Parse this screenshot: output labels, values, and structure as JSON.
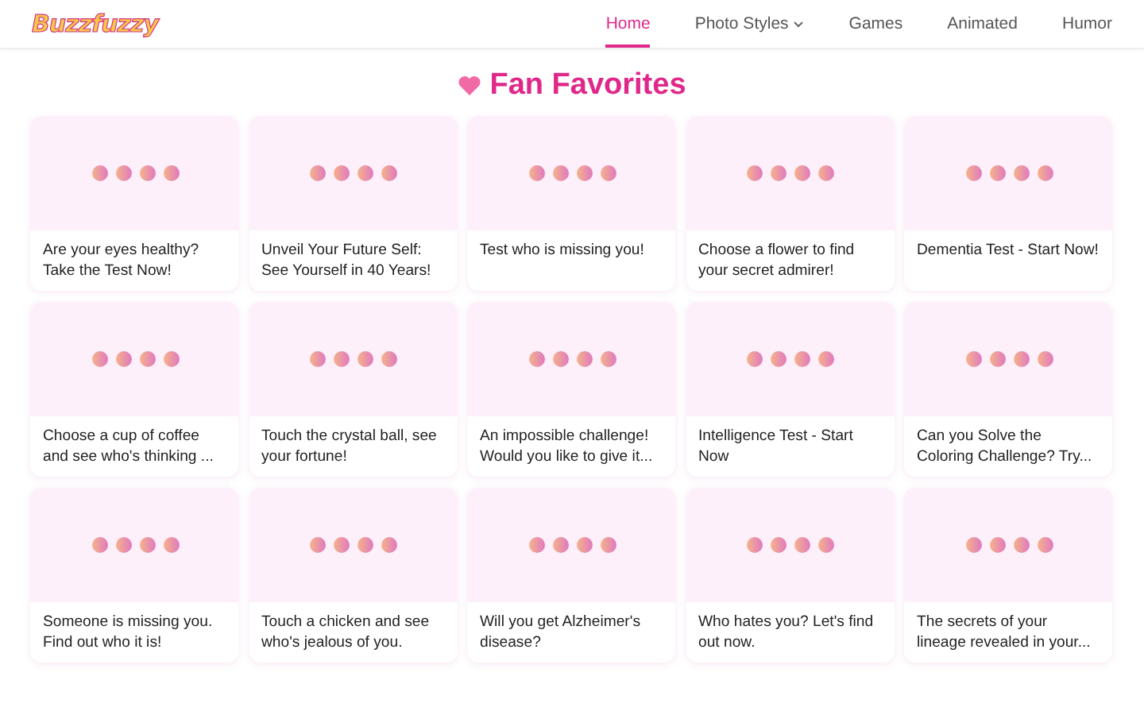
{
  "logo": "Buzzfuzzy",
  "nav": [
    {
      "label": "Home",
      "selected": true,
      "dropdown": false
    },
    {
      "label": "Photo Styles",
      "selected": false,
      "dropdown": true
    },
    {
      "label": "Games",
      "selected": false,
      "dropdown": false
    },
    {
      "label": "Animated",
      "selected": false,
      "dropdown": false
    },
    {
      "label": "Humor",
      "selected": false,
      "dropdown": false
    }
  ],
  "heading": "Fan Favorites",
  "cards": [
    {
      "title": "Are your eyes healthy? Take the Test Now!"
    },
    {
      "title": "Unveil Your Future Self: See Yourself in 40 Years!"
    },
    {
      "title": "Test who is missing you!"
    },
    {
      "title": "Choose a flower to find your secret admirer!"
    },
    {
      "title": "Dementia Test - Start Now!"
    },
    {
      "title": "Choose a cup of coffee and see who's thinking ..."
    },
    {
      "title": "Touch the crystal ball, see your fortune!"
    },
    {
      "title": "An impossible challenge! Would you like to give it..."
    },
    {
      "title": "Intelligence Test - Start Now"
    },
    {
      "title": "Can you Solve the Coloring Challenge? Try..."
    },
    {
      "title": "Someone is missing you. Find out who it is!"
    },
    {
      "title": "Touch a chicken and see who's jealous of you."
    },
    {
      "title": "Will you get Alzheimer's disease?"
    },
    {
      "title": "Who hates you? Let's find out now."
    },
    {
      "title": "The secrets of your lineage revealed in your..."
    }
  ]
}
